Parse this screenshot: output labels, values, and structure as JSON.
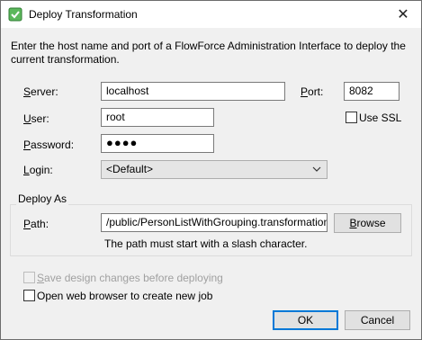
{
  "window": {
    "title": "Deploy Transformation",
    "close_glyph": "✕"
  },
  "intro": "Enter the host name and port of a FlowForce Administration Interface to deploy the current transformation.",
  "server": {
    "label_first": "S",
    "label_rest": "erver:",
    "value": "localhost"
  },
  "port": {
    "label_first": "P",
    "label_rest": "ort:",
    "value": "8082"
  },
  "user": {
    "label_first": "U",
    "label_rest": "ser:",
    "value": "root"
  },
  "use_ssl": {
    "label": "Use SSL",
    "checked": false
  },
  "password": {
    "label_first": "P",
    "label_rest": "assword:",
    "value": "●●●●"
  },
  "login": {
    "label_first": "L",
    "label_rest": "ogin:",
    "value": "<Default>"
  },
  "deploy_as": {
    "title": "Deploy As",
    "path_label_first": "P",
    "path_label_rest": "ath:",
    "path_value": "/public/PersonListWithGrouping.transformation",
    "browse_label_first": "B",
    "browse_label_rest": "rowse",
    "hint": "The path must start with a slash character."
  },
  "save_design": {
    "label_first": "S",
    "label_rest": "ave design changes before deploying",
    "enabled": false
  },
  "open_browser": {
    "label_before": "Open web browser to create new ",
    "label_underlined": "j",
    "label_after": "ob"
  },
  "buttons": {
    "ok": "OK",
    "cancel": "Cancel"
  },
  "colors": {
    "accent": "#0078d7",
    "app_icon": "#4caf50"
  }
}
